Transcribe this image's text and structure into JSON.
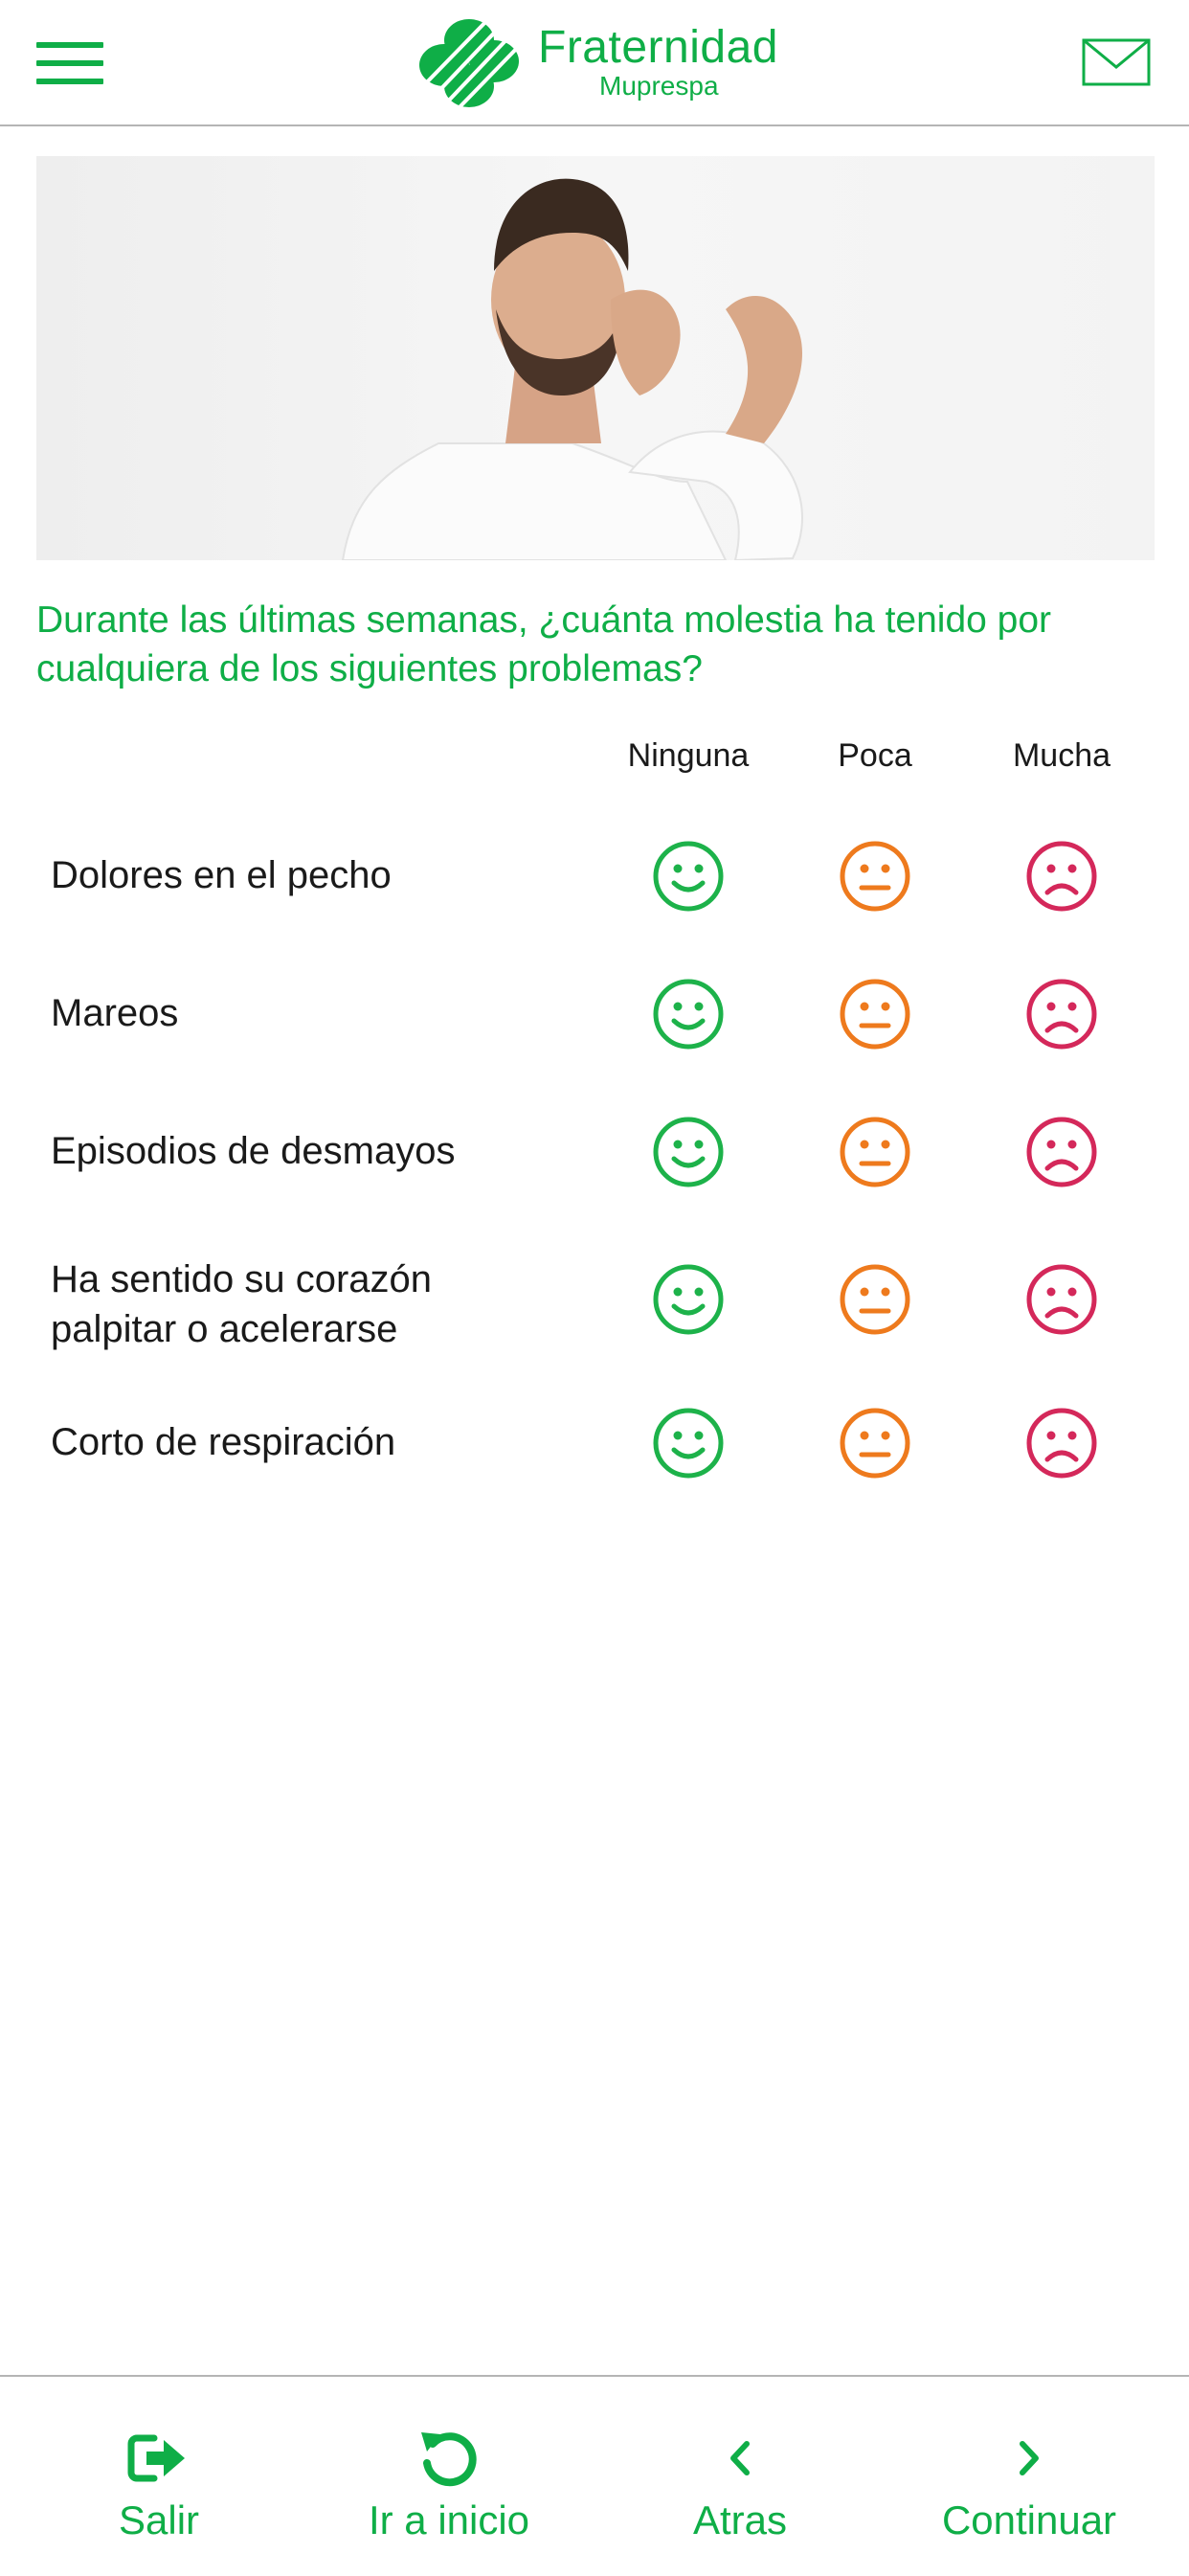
{
  "header": {
    "brand_name": "Fraternidad",
    "brand_sub": "Muprespа",
    "menu_icon": "hamburger-menu-icon",
    "mail_icon": "envelope-icon"
  },
  "hero": {
    "description_icon": "photo-man-neck-pain"
  },
  "question": "Durante las últimas semanas, ¿cuánta molestia ha tenido por cualquiera de los siguientes problemas?",
  "scale": {
    "ninguna": "Ninguna",
    "poca": "Poca",
    "mucha": "Mucha"
  },
  "rows": [
    {
      "label": "Dolores en el pecho"
    },
    {
      "label": "Mareos"
    },
    {
      "label": "Episodios de desmayos"
    },
    {
      "label": "Ha sentido su corazón palpitar o acelerarse"
    },
    {
      "label": "Corto de respiración"
    }
  ],
  "footer": {
    "salir": "Salir",
    "inicio": "Ir a inicio",
    "atras": "Atras",
    "continuar": "Continuar"
  },
  "colors": {
    "brand_green": "#0fae47",
    "ninguna": "#1db24a",
    "poca": "#ee7a1d",
    "mucha": "#d4285a"
  }
}
